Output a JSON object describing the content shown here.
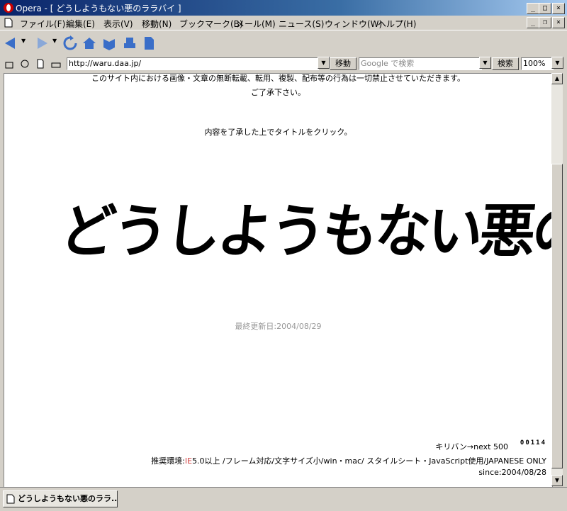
{
  "window": {
    "title": "Opera - [ どうしようもない悪のララバイ ]",
    "controls": {
      "minimize": "_",
      "maximize": "□",
      "close": "×"
    }
  },
  "menubar": {
    "items": [
      "ファイル(F)",
      "編集(E)",
      "表示(V)",
      "移動(N)",
      "ブックマーク(B)",
      "メール(M)",
      "ニュース(S)",
      "ウィンドウ(W)",
      "ヘルプ(H)"
    ]
  },
  "toolbar": {
    "icons": [
      "back-icon",
      "forward-icon",
      "reload-icon",
      "home-icon",
      "bookmark-icon",
      "print-icon",
      "page-icon"
    ]
  },
  "addressbar": {
    "url": "http://waru.daa.jp/",
    "go_label": "移動",
    "search_placeholder": "Google で検索",
    "search_button": "検索",
    "zoom": "100%"
  },
  "content": {
    "notice_line1": "このサイト内における画像・文章の無断転載、転用、複製、配布等の行為は一切禁止させていただきます。",
    "notice_line2": "ご了承下さい。",
    "instruction": "内容を了承した上でタイトルをクリック。",
    "site_title": "どうしようもない悪のララバイ",
    "last_updated": "最終更新日:2004/08/29",
    "kiriban": "キリバン→next 500",
    "counter": "00114",
    "recommended_prefix": "推奨環境:",
    "recommended_ie": "IE",
    "recommended_rest": "5.0以上 /フレーム対応/文字サイズ小/win・mac/ スタイルシート・JavaScript使用/JAPANESE ONLY",
    "since": "since:2004/08/28"
  },
  "tabs": [
    {
      "label": "どうしようもない悪のララ..."
    }
  ]
}
